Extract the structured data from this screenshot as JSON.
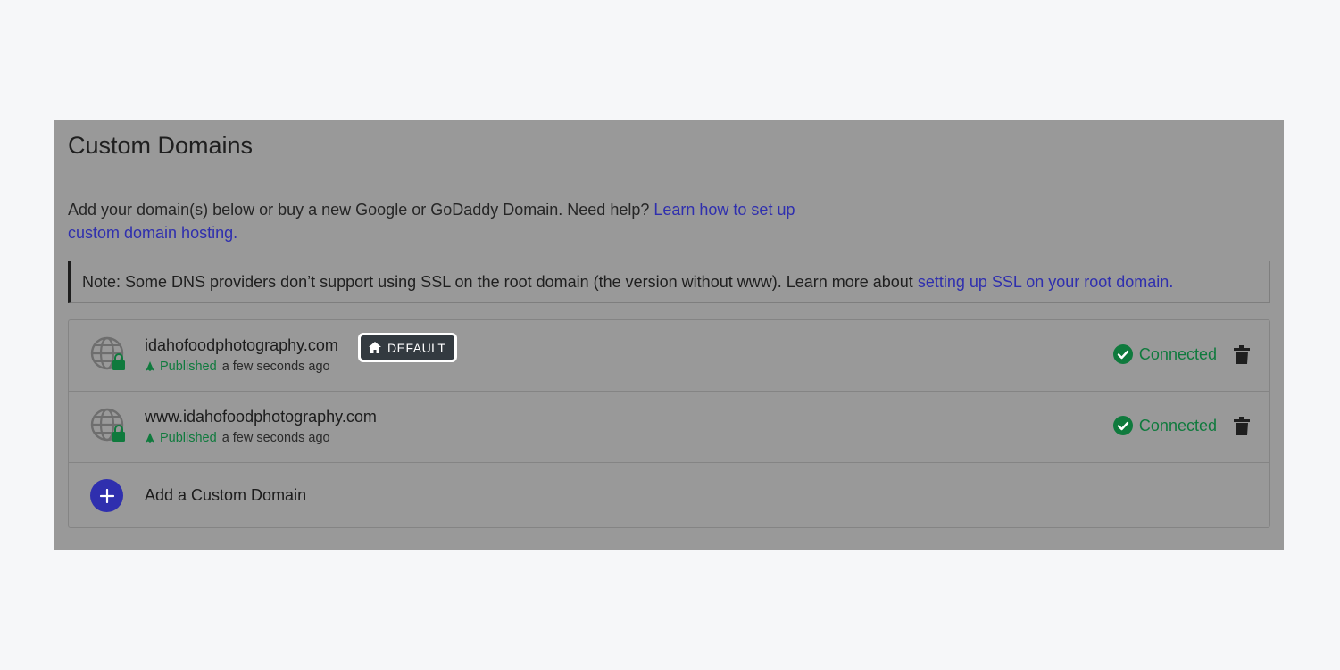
{
  "panel": {
    "title": "Custom Domains",
    "description": "Add your domain(s) below or buy a new Google or GoDaddy Domain. Need help? ",
    "description_link": "Learn how to set up custom domain hosting.",
    "note_text": "Note: Some DNS providers don’t support using SSL on the root domain (the version without www). Learn more about ",
    "note_link": "setting up SSL on your root domain."
  },
  "domains": [
    {
      "name": "idahofoodphotography.com",
      "badge": "DEFAULT",
      "published_label": "Published",
      "published_time": "a few seconds ago",
      "status": "Connected"
    },
    {
      "name": "www.idahofoodphotography.com",
      "published_label": "Published",
      "published_time": "a few seconds ago",
      "status": "Connected"
    }
  ],
  "add_domain": {
    "label": "Add a Custom Domain"
  },
  "icons": {
    "globe": "globe-lock-icon",
    "badge": "home-icon",
    "published": "rocket-icon",
    "status": "check-circle-icon",
    "delete": "trash-icon",
    "add": "plus-icon"
  },
  "colors": {
    "accent": "#2f2fae",
    "success": "#0f7a3d",
    "overlay": "#999999",
    "badge_bg": "#333a40"
  }
}
